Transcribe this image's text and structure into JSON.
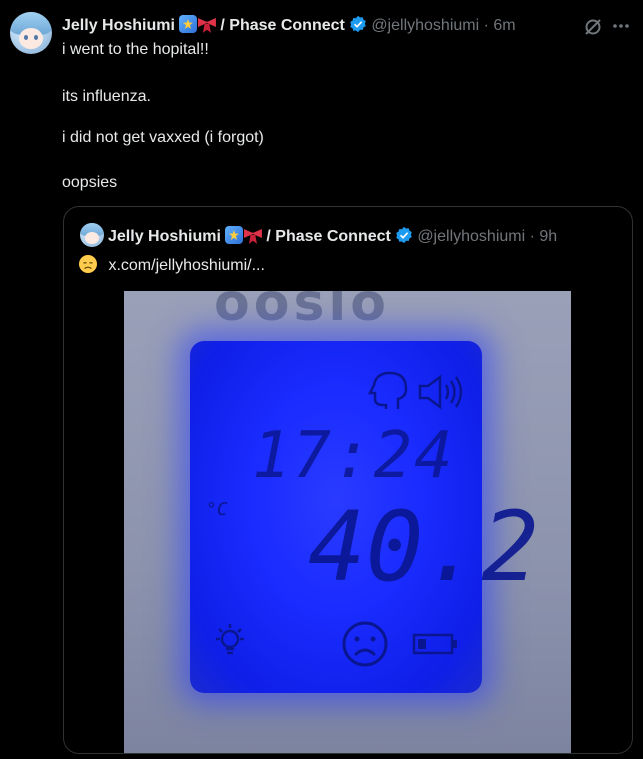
{
  "post": {
    "author_name": "Jelly Hoshiumi",
    "affiliation": "/ Phase Connect",
    "handle": "@jellyhoshiumi",
    "separator": "·",
    "time": "6m",
    "lines": [
      "i went to the hopital!!",
      "its influenza.",
      "i did not get vaxxed (i forgot)",
      "oopsies"
    ]
  },
  "quote": {
    "author_name": "Jelly Hoshiumi",
    "affiliation": "/ Phase Connect",
    "handle": "@jellyhoshiumi",
    "separator": "·",
    "time": "9h",
    "link_text": "x.com/jellyhoshiumi/...",
    "thermometer": {
      "time_display": "17:24",
      "unit": "°C",
      "temperature": "40.2"
    }
  },
  "icons": {
    "verified": "verified-badge-icon",
    "grok": "grok-icon",
    "more": "more-icon",
    "sad_emoji": "disappointed-face-icon"
  },
  "colors": {
    "background": "#000000",
    "text": "#e7e9ea",
    "secondary": "#71767b",
    "verified": "#1d9bf0",
    "border": "#2f3336"
  }
}
